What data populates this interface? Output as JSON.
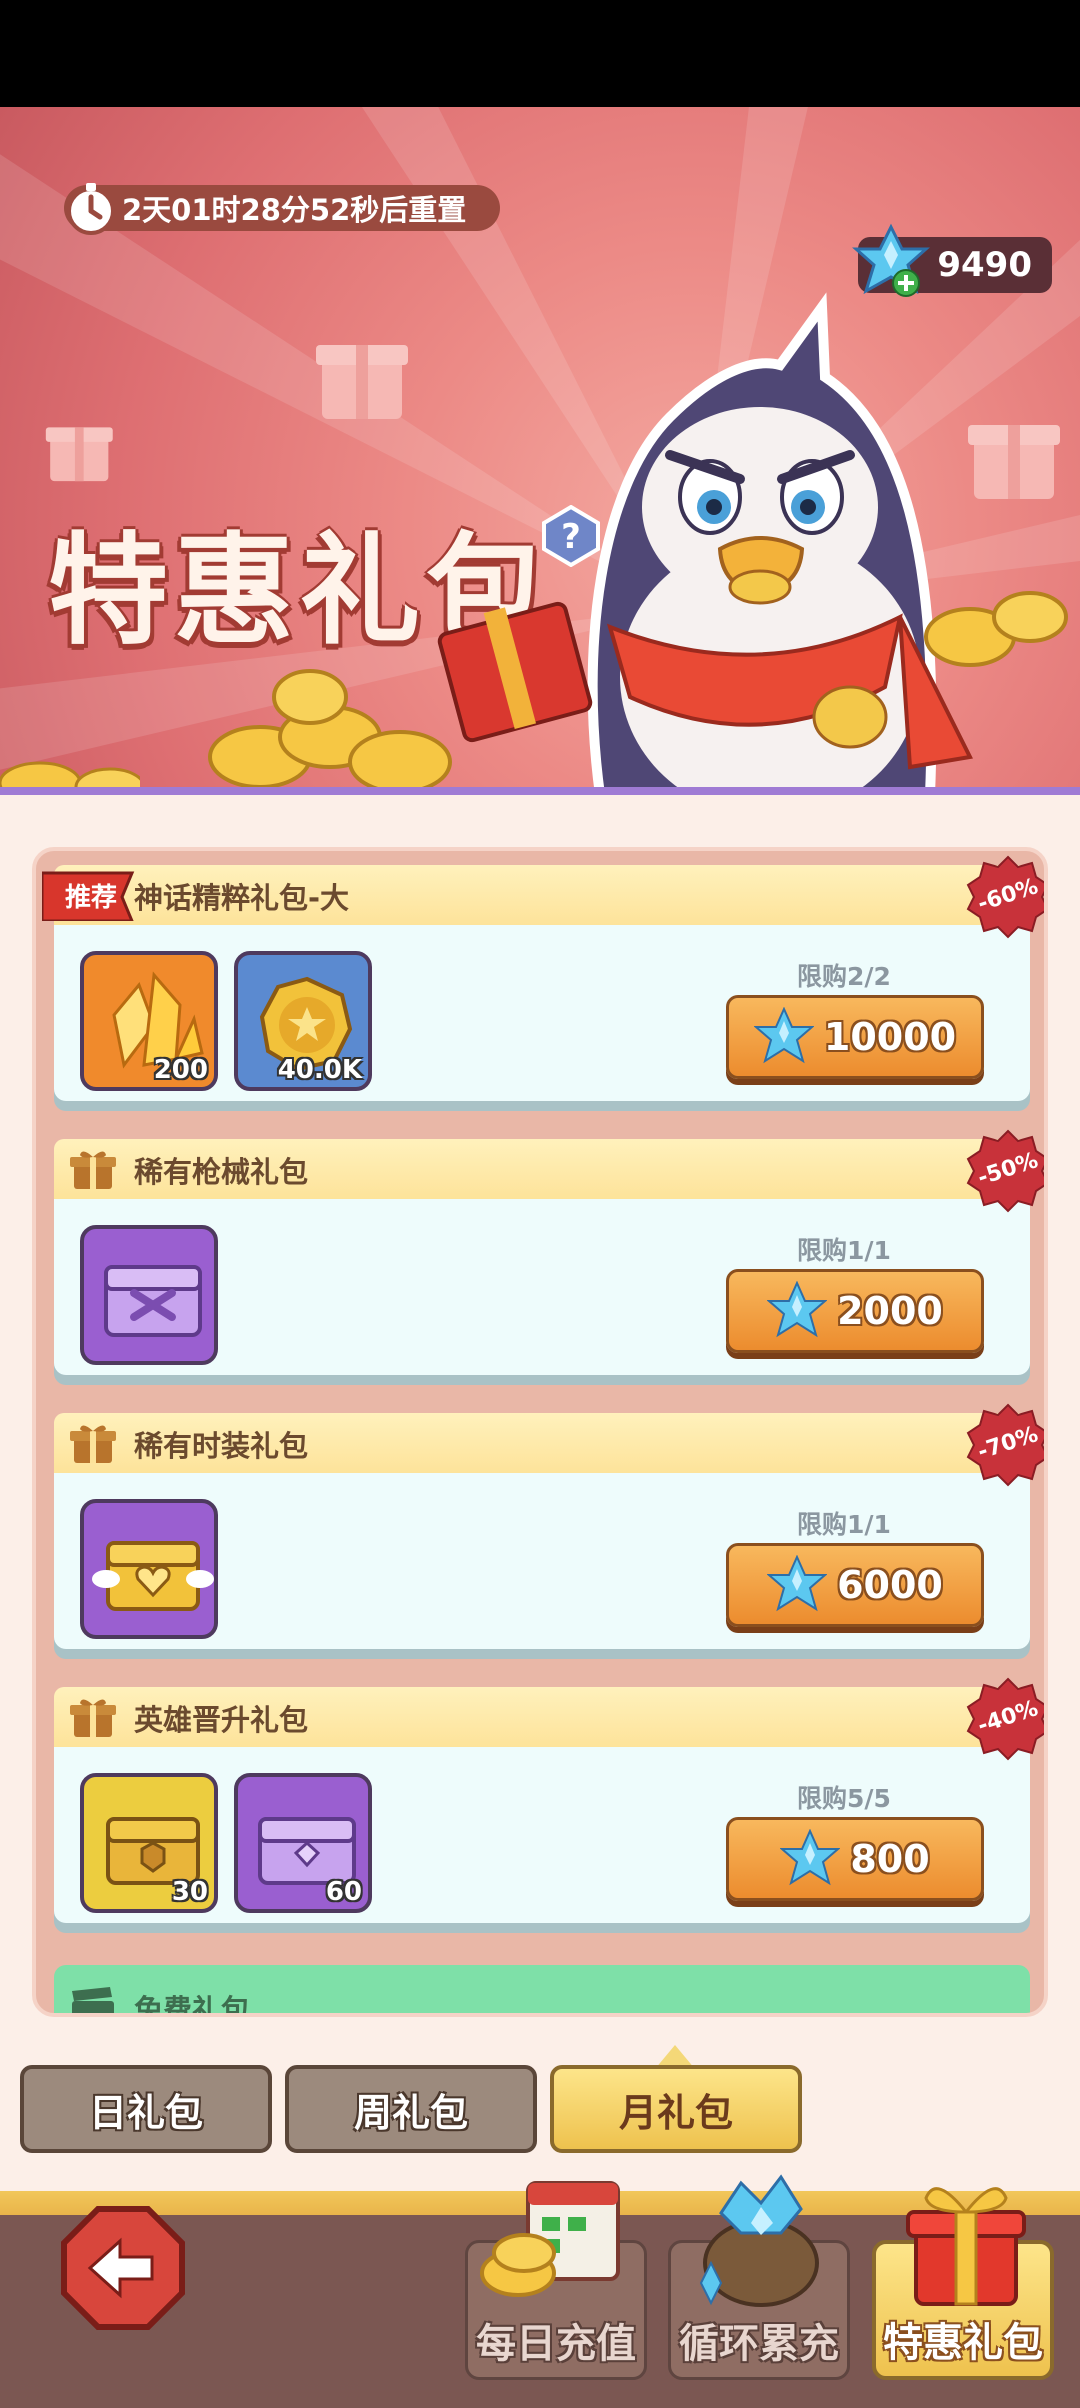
{
  "header": {
    "timer_text": "2天01时28分52秒后重置",
    "currency_amount": "9490",
    "title": "特惠礼包"
  },
  "packs": [
    {
      "title": "神话精粹礼包-大",
      "badge": "推荐",
      "discount": "-60%",
      "limit": "限购2/2",
      "price": "10000",
      "items": [
        {
          "icon": "crystal-shard-icon",
          "count": "200",
          "bg": "#f08a2c"
        },
        {
          "icon": "gold-coin-icon",
          "count": "40.0K",
          "bg": "#5b8ad0"
        }
      ]
    },
    {
      "title": "稀有枪械礼包",
      "discount": "-50%",
      "limit": "限购1/1",
      "price": "2000",
      "items": [
        {
          "icon": "purple-chest-icon",
          "count": "",
          "bg": "#9a5fd0"
        }
      ]
    },
    {
      "title": "稀有时装礼包",
      "discount": "-70%",
      "limit": "限购1/1",
      "price": "6000",
      "items": [
        {
          "icon": "golden-heart-chest-icon",
          "count": "",
          "bg": "#9a5fd0"
        }
      ]
    },
    {
      "title": "英雄晋升礼包",
      "discount": "-40%",
      "limit": "限购5/5",
      "price": "800",
      "items": [
        {
          "icon": "gold-chest-icon",
          "count": "30",
          "bg": "#eccd3f"
        },
        {
          "icon": "purple-chest-icon",
          "count": "60",
          "bg": "#9a5fd0"
        }
      ]
    }
  ],
  "free_pack": {
    "title": "免费礼包"
  },
  "tabs": [
    {
      "label": "日礼包",
      "active": false
    },
    {
      "label": "周礼包",
      "active": false
    },
    {
      "label": "月礼包",
      "active": true
    }
  ],
  "bottom_nav": [
    {
      "label": "每日充值",
      "icon": "calendar-coins-icon",
      "active": false
    },
    {
      "label": "循环累充",
      "icon": "crystal-bag-icon",
      "active": false
    },
    {
      "label": "特惠礼包",
      "icon": "gift-box-icon",
      "active": true
    }
  ],
  "colors": {
    "banner": "#de6f72",
    "button": "#ec8c2e",
    "active_tab": "#eec24e",
    "crystal": "#4fc3f7"
  }
}
